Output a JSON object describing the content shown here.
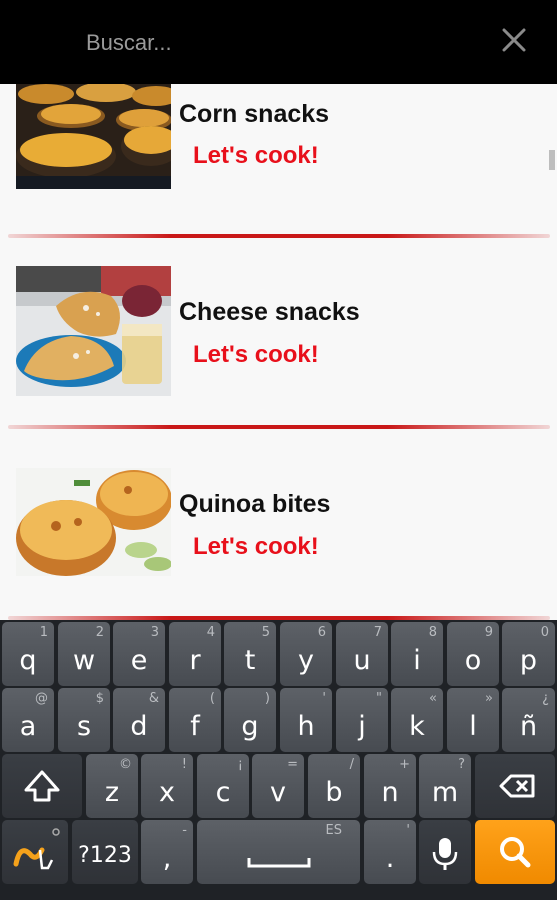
{
  "search": {
    "placeholder": "Buscar..."
  },
  "icons": {
    "close": "close-icon",
    "search": "search-icon",
    "shift": "shift-icon",
    "backspace": "backspace-icon",
    "mic": "mic-icon",
    "swype": "swype-icon",
    "space": "space-icon"
  },
  "colors": {
    "accent": "#e8101b",
    "divider": "#c91818",
    "action_key": "#f79400"
  },
  "recipes": [
    {
      "title": "Corn snacks",
      "cta": "Let's cook!"
    },
    {
      "title": "Cheese snacks",
      "cta": "Let's cook!"
    },
    {
      "title": "Quinoa bites",
      "cta": "Let's cook!"
    }
  ],
  "keyboard": {
    "row1": [
      {
        "k": "q",
        "a": "1"
      },
      {
        "k": "w",
        "a": "2"
      },
      {
        "k": "e",
        "a": "3"
      },
      {
        "k": "r",
        "a": "4"
      },
      {
        "k": "t",
        "a": "5"
      },
      {
        "k": "y",
        "a": "6"
      },
      {
        "k": "u",
        "a": "7"
      },
      {
        "k": "i",
        "a": "8"
      },
      {
        "k": "o",
        "a": "9"
      },
      {
        "k": "p",
        "a": "0"
      }
    ],
    "row2": [
      {
        "k": "a",
        "a": "@"
      },
      {
        "k": "s",
        "a": "$"
      },
      {
        "k": "d",
        "a": "&"
      },
      {
        "k": "f",
        "a": "("
      },
      {
        "k": "g",
        "a": ")"
      },
      {
        "k": "h",
        "a": "'"
      },
      {
        "k": "j",
        "a": "\""
      },
      {
        "k": "k",
        "a": "«"
      },
      {
        "k": "l",
        "a": "»"
      },
      {
        "k": "ñ",
        "a": "¿"
      }
    ],
    "row3": [
      {
        "k": "z",
        "a": "©"
      },
      {
        "k": "x",
        "a": "!"
      },
      {
        "k": "c",
        "a": "¡"
      },
      {
        "k": "v",
        "a": "="
      },
      {
        "k": "b",
        "a": "/"
      },
      {
        "k": "n",
        "a": "+"
      },
      {
        "k": "m",
        "a": "?"
      }
    ],
    "symbols_label": "?123",
    "comma": ",",
    "comma_alt": "-",
    "language": "ES",
    "period": ".",
    "period_alt": "'"
  }
}
